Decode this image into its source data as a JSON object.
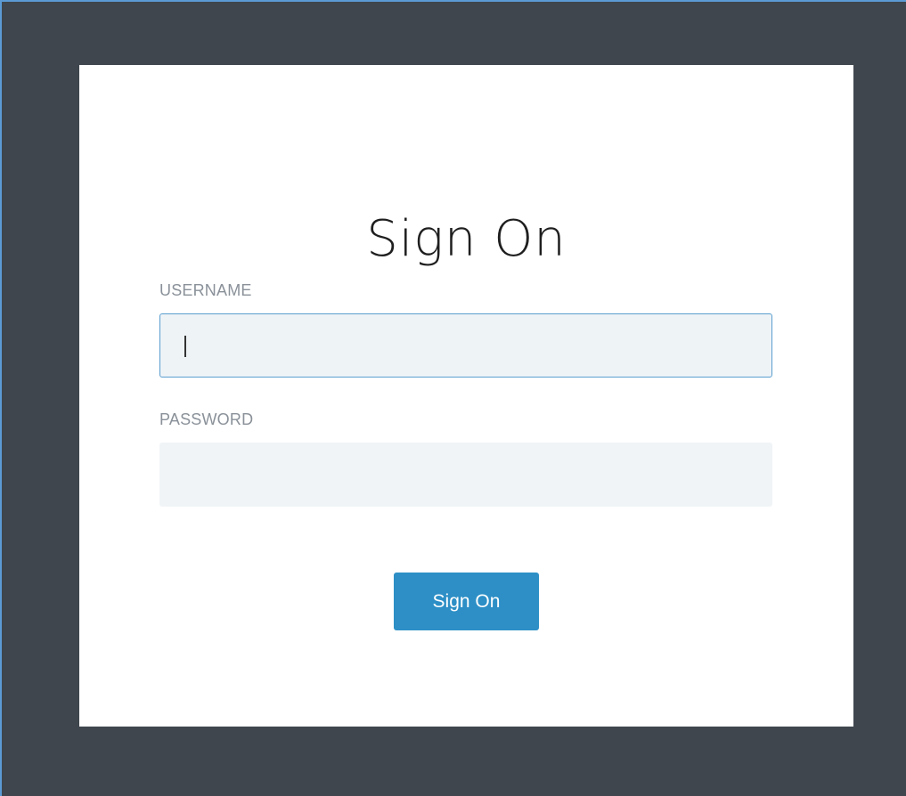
{
  "signon": {
    "title": "Sign On",
    "username_label": "USERNAME",
    "username_value": "",
    "password_label": "PASSWORD",
    "password_value": "",
    "submit_label": "Sign On"
  },
  "colors": {
    "backdrop": "#3f464d",
    "card": "#ffffff",
    "input_bg": "#eef3f6",
    "input_focus_border": "#5b9fcf",
    "label": "#8a9199",
    "button": "#2d8fc6"
  }
}
